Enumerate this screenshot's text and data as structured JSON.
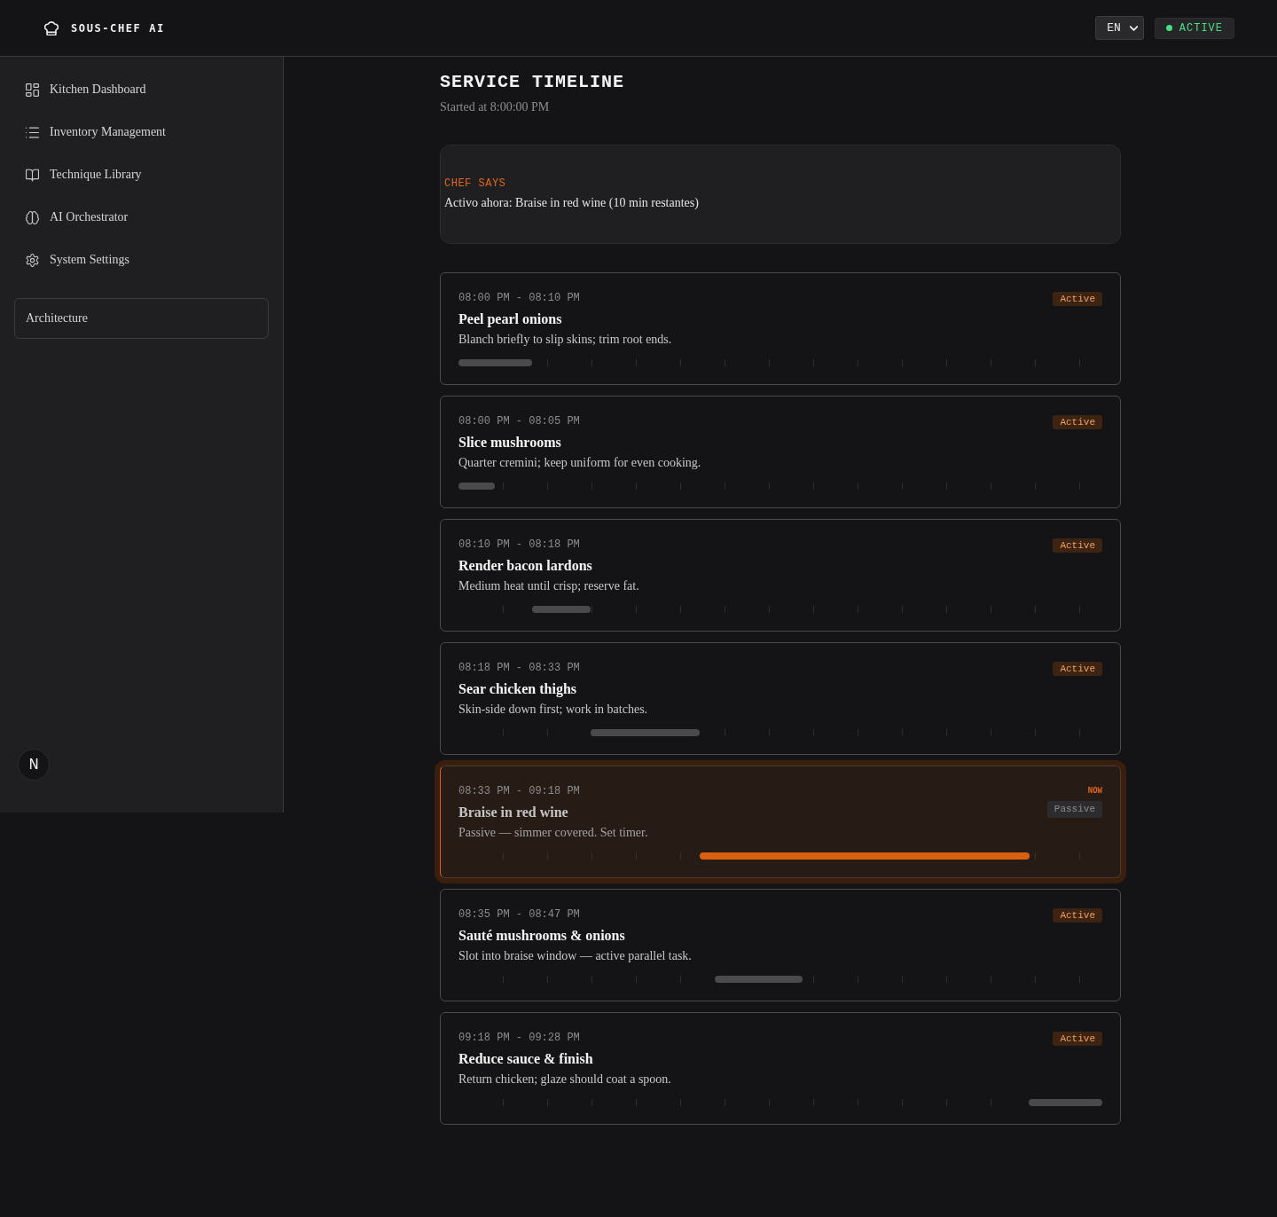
{
  "header": {
    "logo_text": "SOUS-CHEF AI",
    "language": "EN",
    "status": "ACTIVE"
  },
  "sidebar": {
    "items": [
      {
        "label": "Kitchen Dashboard",
        "selected": false
      },
      {
        "label": "Inventory Management",
        "selected": false
      },
      {
        "label": "Technique Library",
        "selected": false
      },
      {
        "label": "AI Orchestrator",
        "selected": false
      },
      {
        "label": "System Settings",
        "selected": false
      }
    ],
    "architecture_button": "Architecture",
    "dev_badge": "N"
  },
  "main": {
    "title": "SERVICE TIMELINE",
    "subtitle": "Started at 8:00:00 PM",
    "chef_says": {
      "label": "CHEF SAYS",
      "message": "Activo ahora: Braise in red wine (10 min restantes)"
    },
    "steps": [
      {
        "time": "08:00 PM - 08:10 PM",
        "title": "Peel pearl onions",
        "description": "Blanch briefly to slip skins; trim root ends.",
        "badge": {
          "label": "Active",
          "kind": "active"
        },
        "current": false
      },
      {
        "time": "08:00 PM - 08:05 PM",
        "title": "Slice mushrooms",
        "description": "Quarter cremini; keep uniform for even cooking.",
        "badge": {
          "label": "Active",
          "kind": "active"
        },
        "current": false
      },
      {
        "time": "08:10 PM - 08:18 PM",
        "title": "Render bacon lardons",
        "description": "Medium heat until crisp; reserve fat.",
        "badge": {
          "label": "Active",
          "kind": "active"
        },
        "current": false
      },
      {
        "time": "08:18 PM - 08:33 PM",
        "title": "Sear chicken thighs",
        "description": "Skin-side down first; work in batches.",
        "badge": {
          "label": "Active",
          "kind": "active"
        },
        "current": false
      },
      {
        "time": "08:33 PM - 09:18 PM",
        "title": "Braise in red wine",
        "description": "Passive — simmer covered. Set timer.",
        "badge": {
          "label": "Passive",
          "kind": "passive"
        },
        "current": true,
        "now_label": "NOW"
      },
      {
        "time": "08:35 PM - 08:47 PM",
        "title": "Sauté mushrooms & onions",
        "description": "Slot into braise window — active parallel task.",
        "badge": {
          "label": "Active",
          "kind": "active"
        },
        "current": false
      },
      {
        "time": "09:18 PM - 09:28 PM",
        "title": "Reduce sauce & finish",
        "description": "Return chicken; glaze should coat a spoon.",
        "badge": {
          "label": "Active",
          "kind": "active"
        },
        "current": false
      }
    ]
  }
}
